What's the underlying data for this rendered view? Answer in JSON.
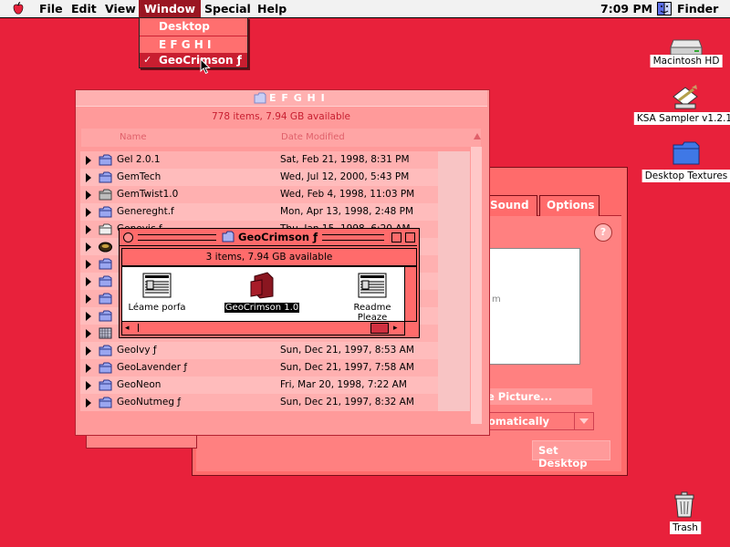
{
  "menubar": {
    "items": [
      "File",
      "Edit",
      "View",
      "Window",
      "Special",
      "Help"
    ],
    "clock": "7:09 PM",
    "app": "Finder"
  },
  "window_menu": {
    "items": [
      {
        "label": "Desktop",
        "checked": false
      },
      {
        "label": "E F G H I",
        "checked": false
      },
      {
        "label": "GeoCrimson ƒ",
        "checked": true
      }
    ],
    "check_mark": "✓"
  },
  "desktop_icons": [
    "Macintosh HD",
    "KSA Sampler v1.2.1",
    "Desktop Textures",
    "Trash"
  ],
  "desktop_window": {
    "tabs": [
      "Sound",
      "Options"
    ],
    "picture_button": "e Picture...",
    "position_select": "omatically",
    "set_desktop_button": "Set Desktop",
    "preview_text": "m",
    "help_glyph": "?"
  },
  "efghi_window": {
    "title": "E F G H I",
    "status": "778 items, 7.94 GB available",
    "col_name": "Name",
    "col_date": "Date Modified",
    "rows": [
      {
        "name": "Gel 2.0.1",
        "date": "Sat, Feb 21, 1998, 8:31 PM",
        "icon": "folder-icon"
      },
      {
        "name": "GemTech",
        "date": "Wed, Jul 12, 2000, 5:43 PM",
        "icon": "folder-icon"
      },
      {
        "name": "GemTwist1.0",
        "date": "Wed, Feb 4, 1998, 11:03 PM",
        "icon": "gray-folder-icon"
      },
      {
        "name": "Genereght.f",
        "date": "Mon, Apr 13, 1998, 2:48 PM",
        "icon": "folder-icon"
      },
      {
        "name": "Genevic.f",
        "date": "Thu, Jan 15, 1998, 6:20 AM",
        "icon": "plain-folder-icon"
      },
      {
        "name": "",
        "date": "",
        "icon": "disk-icon"
      },
      {
        "name": "",
        "date": "",
        "icon": "folder-icon"
      },
      {
        "name": "",
        "date": "",
        "icon": "folder-icon"
      },
      {
        "name": "",
        "date": "",
        "icon": "folder-icon"
      },
      {
        "name": "",
        "date": "",
        "icon": "folder-icon"
      },
      {
        "name": "",
        "date": "",
        "icon": "grid-folder-icon"
      },
      {
        "name": "GeoIvy ƒ",
        "date": "Sun, Dec 21, 1997, 8:53 AM",
        "icon": "folder-icon"
      },
      {
        "name": "GeoLavender ƒ",
        "date": "Sun, Dec 21, 1997, 7:58 AM",
        "icon": "folder-icon"
      },
      {
        "name": "GeoNeon",
        "date": "Fri, Mar 20, 1998, 7:22 AM",
        "icon": "folder-icon"
      },
      {
        "name": "GeoNutmeg ƒ",
        "date": "Sun, Dec 21, 1997, 8:32 AM",
        "icon": "folder-icon"
      }
    ]
  },
  "geo_window": {
    "title": "GeoCrimson ƒ",
    "status": "3 items, 7.94 GB available",
    "items": [
      "Léame porfa",
      "GeoCrimson 1.0",
      "Readme Pleaze"
    ]
  },
  "colors": {
    "desktop": "#e8213b",
    "accent_dark": "#9a1622",
    "window_light": "#ff9a9a",
    "window_mid": "#ff6b6b"
  }
}
